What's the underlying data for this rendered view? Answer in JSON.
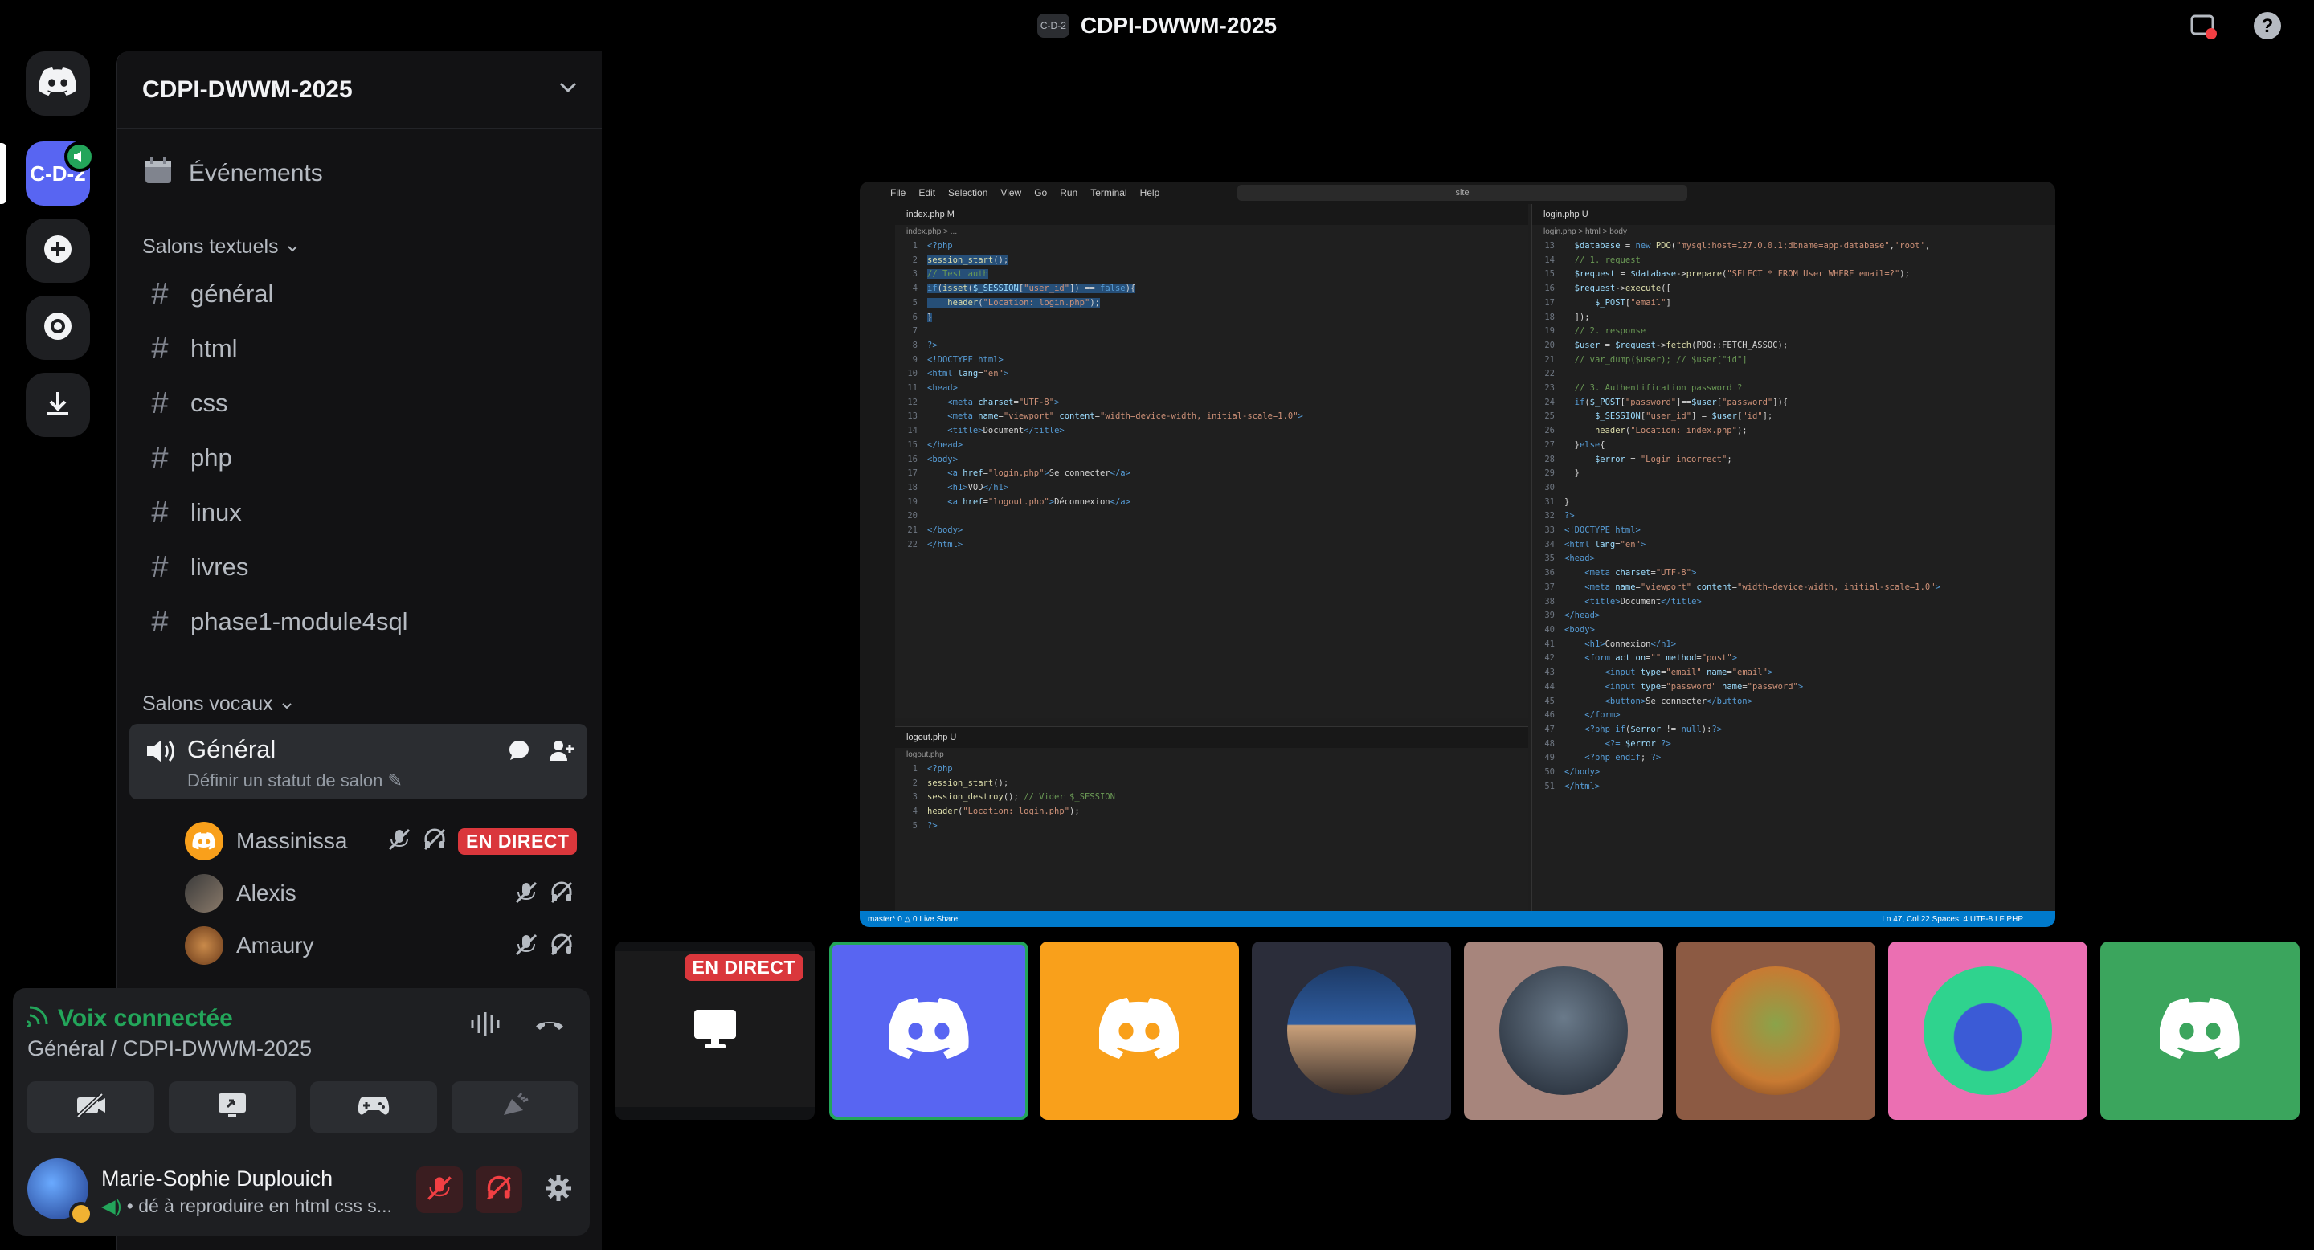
{
  "window": {
    "badge": "C-D-2",
    "title": "CDPI-DWWM-2025"
  },
  "server_rail": {
    "server_abbrev": "C-D-2"
  },
  "guild": {
    "name": "CDPI-DWWM-2025",
    "events_label": "Événements"
  },
  "text_channels": {
    "category": "Salons textuels",
    "channels": [
      "général",
      "html",
      "css",
      "php",
      "linux",
      "livres",
      "phase1-module4sql"
    ]
  },
  "voice_channels": {
    "category": "Salons vocaux",
    "active": {
      "name": "Général",
      "status": "Définir un statut de salon"
    },
    "users": [
      {
        "name": "Massinissa",
        "live": "EN DIRECT"
      },
      {
        "name": "Alexis"
      },
      {
        "name": "Amaury"
      }
    ]
  },
  "voice_panel": {
    "status": "Voix connectée",
    "location": "Général / CDPI-DWWM-2025"
  },
  "user": {
    "name": "Marie-Sophie Duplouich",
    "status": "• dé à reproduire en html css s..."
  },
  "stream": {
    "menu": [
      "File",
      "Edit",
      "Selection",
      "View",
      "Go",
      "Run",
      "Terminal",
      "Help"
    ],
    "search": "site",
    "tab_index": "index.php M",
    "crumb_index": "index.php > ...",
    "tab_logout": "logout.php U",
    "crumb_logout": "logout.php",
    "tab_login": "login.php U",
    "crumb_login": "login.php > html > body",
    "status_left": "master*   0 △ 0   Live Share",
    "status_right": "Ln 47, Col 22   Spaces: 4   UTF-8   LF   PHP"
  },
  "tiles": {
    "live_badge": "EN DIRECT"
  },
  "colors": {
    "blurple": "#5865f2",
    "green": "#23a55a",
    "red": "#da373c",
    "orange": "#f9a01b",
    "pink": "#eb6fb2"
  }
}
